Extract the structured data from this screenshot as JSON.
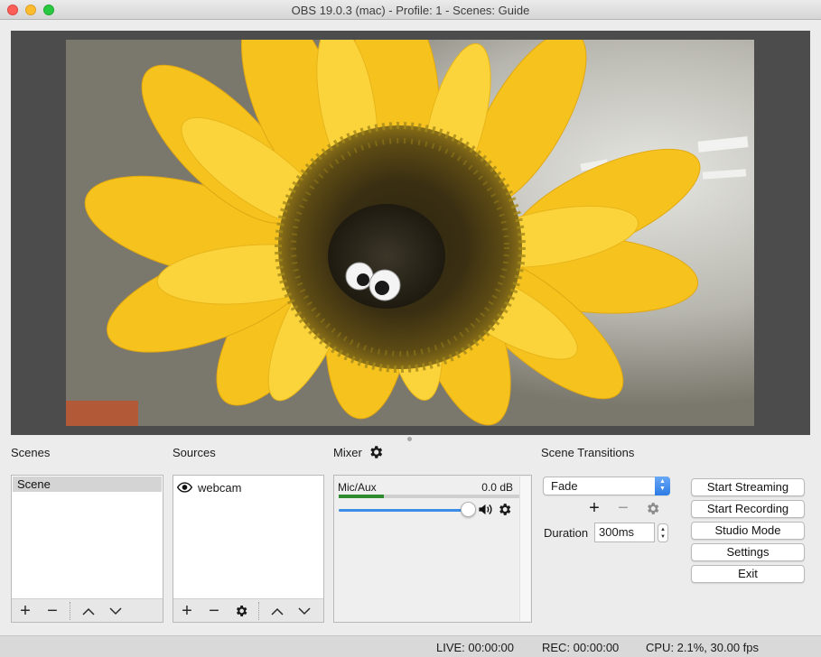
{
  "window": {
    "title": "OBS 19.0.3 (mac) - Profile: 1 - Scenes: Guide"
  },
  "preview": {
    "source_name": "webcam",
    "image_description_icon": "sunflower-webcam-feed"
  },
  "scenes": {
    "label": "Scenes",
    "items": [
      "Scene"
    ],
    "selected": "Scene",
    "toolbar_icons": [
      "plus-icon",
      "minus-icon",
      "chevron-up-icon",
      "chevron-down-icon"
    ]
  },
  "sources": {
    "label": "Sources",
    "items": [
      {
        "name": "webcam",
        "visible_icon": "eye-icon"
      }
    ],
    "toolbar_icons": [
      "plus-icon",
      "minus-icon",
      "gear-icon",
      "chevron-up-icon",
      "chevron-down-icon"
    ]
  },
  "mixer": {
    "label": "Mixer",
    "channels": [
      {
        "name": "Mic/Aux",
        "db": "0.0 dB",
        "meter_level": 0.25,
        "volume": 1.0
      }
    ],
    "colors": {
      "meter": "#2e8b2e",
      "slider": "#3b8de6"
    }
  },
  "transitions": {
    "label": "Scene Transitions",
    "selected": "Fade",
    "duration_label": "Duration",
    "duration_value": "300ms"
  },
  "controls": {
    "start_streaming": "Start Streaming",
    "start_recording": "Start Recording",
    "studio_mode": "Studio Mode",
    "settings": "Settings",
    "exit": "Exit"
  },
  "status": {
    "live": "LIVE: 00:00:00",
    "rec": "REC: 00:00:00",
    "cpu": "CPU: 2.1%, 30.00 fps"
  }
}
